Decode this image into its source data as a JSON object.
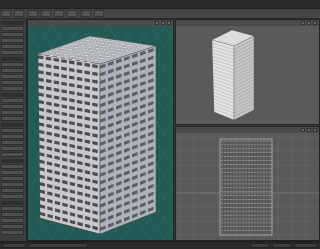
{
  "window": {
    "title": ""
  },
  "viewports": {
    "perspective": {
      "label": "",
      "icon": "camera-icon"
    },
    "top_right": {
      "label": "",
      "icon": "camera-icon"
    },
    "bottom_right": {
      "label": "",
      "icon": "camera-icon"
    }
  },
  "colors": {
    "perspective_bg": "#225b56",
    "ortho_bg": "#5a5a5a",
    "building_face": "#c9c9c9",
    "window_dark": "#4a4a58",
    "grid_line": "#6b6b6b"
  }
}
